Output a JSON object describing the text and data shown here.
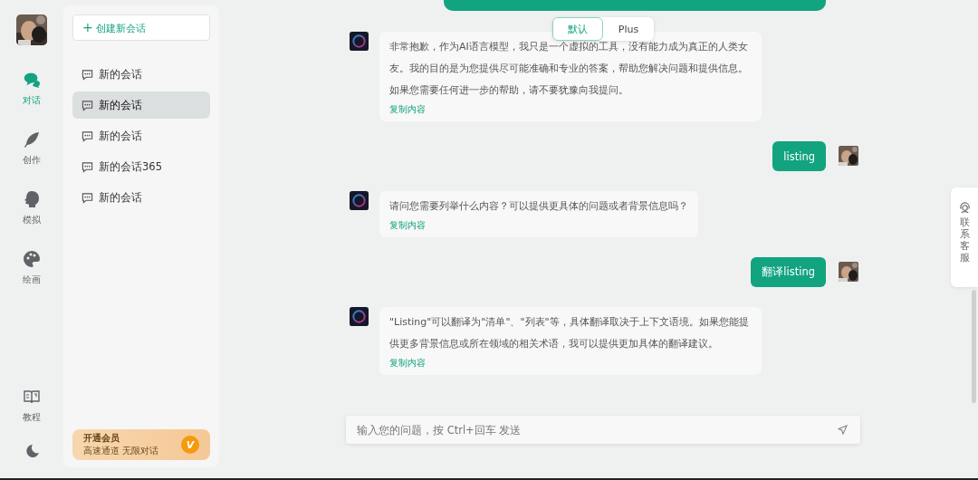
{
  "nav": {
    "items": [
      {
        "label": "对话",
        "kind": "chat",
        "selected": true
      },
      {
        "label": "创作",
        "kind": "feather",
        "selected": false
      },
      {
        "label": "模拟",
        "kind": "head",
        "selected": false
      },
      {
        "label": "绘画",
        "kind": "palette",
        "selected": false
      }
    ],
    "bottom": [
      {
        "label": "教程",
        "kind": "book"
      },
      {
        "kind": "moon"
      }
    ]
  },
  "sidebar": {
    "new_chat": "创建新会话",
    "plus": "+",
    "conversations": [
      {
        "title": "新的会话",
        "selected": false
      },
      {
        "title": "新的会话",
        "selected": true
      },
      {
        "title": "新的会话",
        "selected": false
      },
      {
        "title": "新的会话365",
        "selected": false
      },
      {
        "title": "新的会话",
        "selected": false
      }
    ],
    "promo": {
      "title": "开通会员",
      "subtitle": "高速通道 无限对话",
      "badge": "V"
    }
  },
  "mode_tabs": [
    {
      "label": "默认",
      "selected": true
    },
    {
      "label": "Plus",
      "selected": false
    }
  ],
  "messages": [
    {
      "kind": "assistant",
      "text": "非常抱歉，作为AI语言模型，我只是一个虚拟的工具，没有能力成为真正的人类女友。我的目的是为您提供尽可能准确和专业的答案，帮助您解决问题和提供信息。如果您需要任何进一步的帮助，请不要犹豫向我提问。",
      "copy": "复制内容"
    },
    {
      "kind": "user",
      "text": "listing"
    },
    {
      "kind": "assistant",
      "text": "请问您需要列举什么内容？可以提供更具体的问题或者背景信息吗？",
      "copy": "复制内容"
    },
    {
      "kind": "user",
      "text": "翻译listing"
    },
    {
      "kind": "assistant",
      "text": "\"Listing\"可以翻译为\"清单\"、\"列表\"等，具体翻译取决于上下文语境。如果您能提供更多背景信息或所在领域的相关术语，我可以提供更加具体的翻译建议。",
      "copy": "复制内容"
    }
  ],
  "input": {
    "placeholder": "输入您的问题，按 Ctrl+回车 发送"
  },
  "contact": {
    "label": "联系客服"
  }
}
